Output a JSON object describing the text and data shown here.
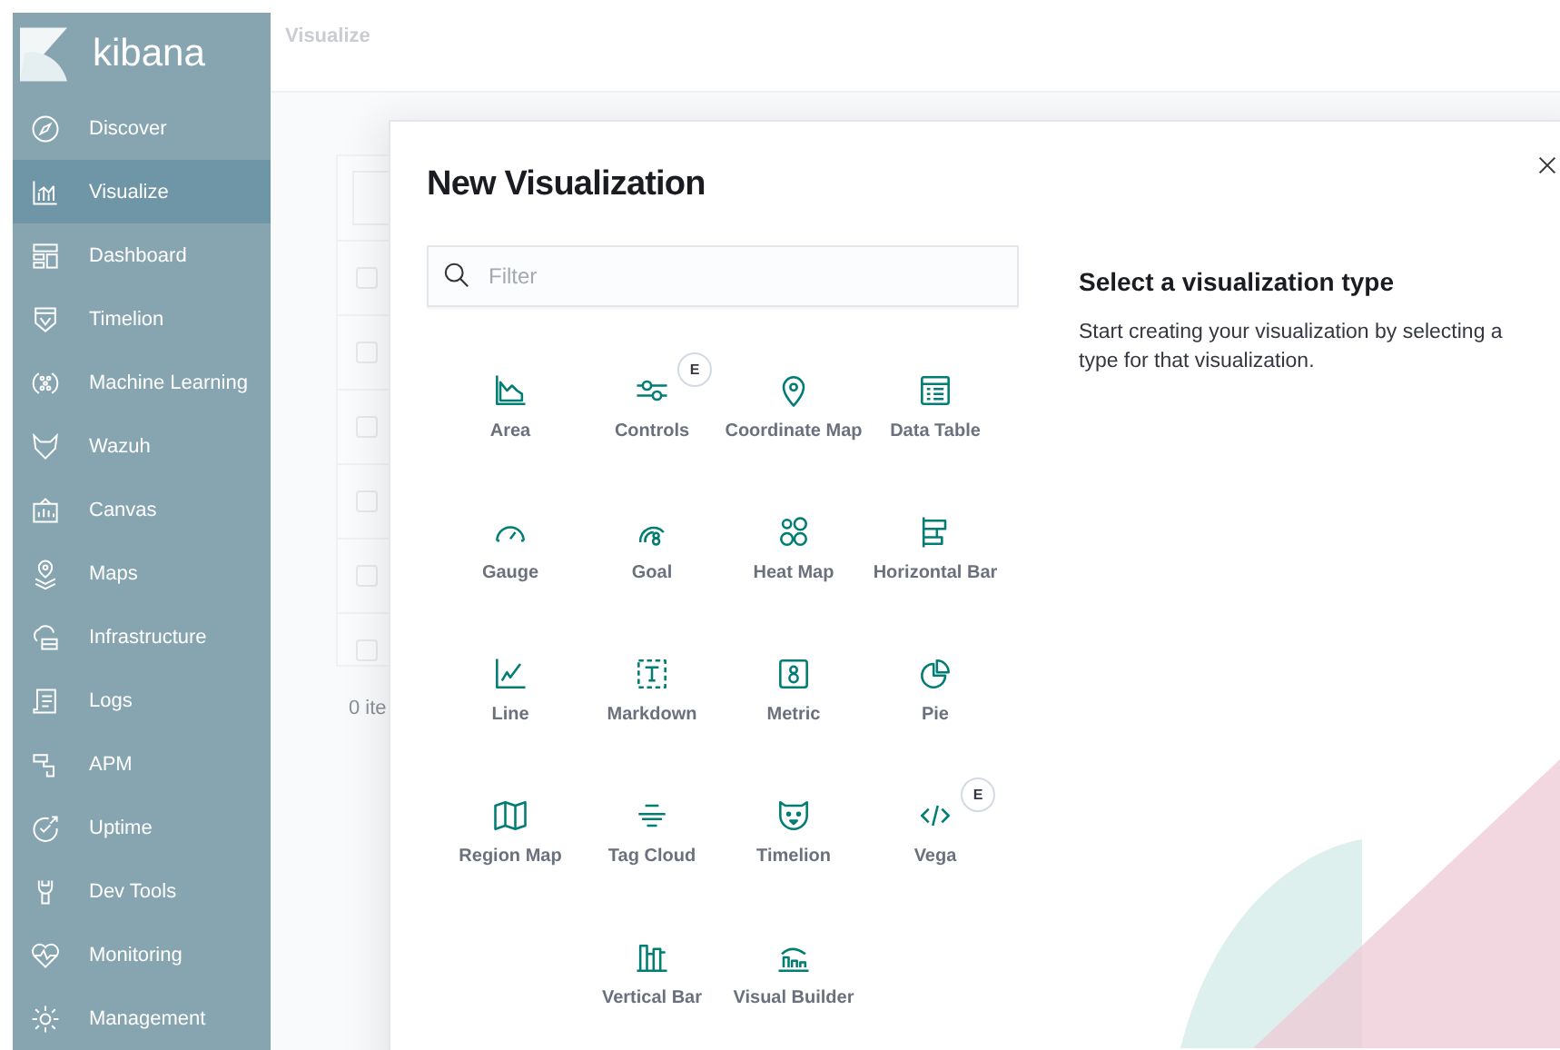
{
  "brand": "kibana",
  "nav": [
    {
      "label": "Discover",
      "selected": false
    },
    {
      "label": "Visualize",
      "selected": true
    },
    {
      "label": "Dashboard",
      "selected": false
    },
    {
      "label": "Timelion",
      "selected": false
    },
    {
      "label": "Machine Learning",
      "selected": false
    },
    {
      "label": "Wazuh",
      "selected": false
    },
    {
      "label": "Canvas",
      "selected": false
    },
    {
      "label": "Maps",
      "selected": false
    },
    {
      "label": "Infrastructure",
      "selected": false
    },
    {
      "label": "Logs",
      "selected": false
    },
    {
      "label": "APM",
      "selected": false
    },
    {
      "label": "Uptime",
      "selected": false
    },
    {
      "label": "Dev Tools",
      "selected": false
    },
    {
      "label": "Monitoring",
      "selected": false
    },
    {
      "label": "Management",
      "selected": false
    }
  ],
  "breadcrumb": "Visualize",
  "background_list": {
    "rows": [
      {
        "checked": false
      },
      {
        "checked": false
      },
      {
        "checked": false
      },
      {
        "checked": false
      },
      {
        "checked": false
      },
      {
        "checked": false
      }
    ],
    "footer": "0 ite"
  },
  "modal": {
    "title": "New Visualization",
    "filter": {
      "placeholder": "Filter"
    },
    "types": [
      {
        "label": "Area"
      },
      {
        "label": "Controls",
        "badge": "E"
      },
      {
        "label": "Coordinate Map"
      },
      {
        "label": "Data Table"
      },
      {
        "label": "Gauge"
      },
      {
        "label": "Goal"
      },
      {
        "label": "Heat Map"
      },
      {
        "label": "Horizontal Bar"
      },
      {
        "label": "Line"
      },
      {
        "label": "Markdown"
      },
      {
        "label": "Metric"
      },
      {
        "label": "Pie"
      },
      {
        "label": "Region Map"
      },
      {
        "label": "Tag Cloud"
      },
      {
        "label": "Timelion"
      },
      {
        "label": "Vega",
        "badge": "E"
      },
      {
        "label": "Vertical Bar"
      },
      {
        "label": "Visual Builder"
      }
    ],
    "info": {
      "heading": "Select a visualization type",
      "text": "Start creating your visualization by selecting a type for that visualization."
    }
  }
}
